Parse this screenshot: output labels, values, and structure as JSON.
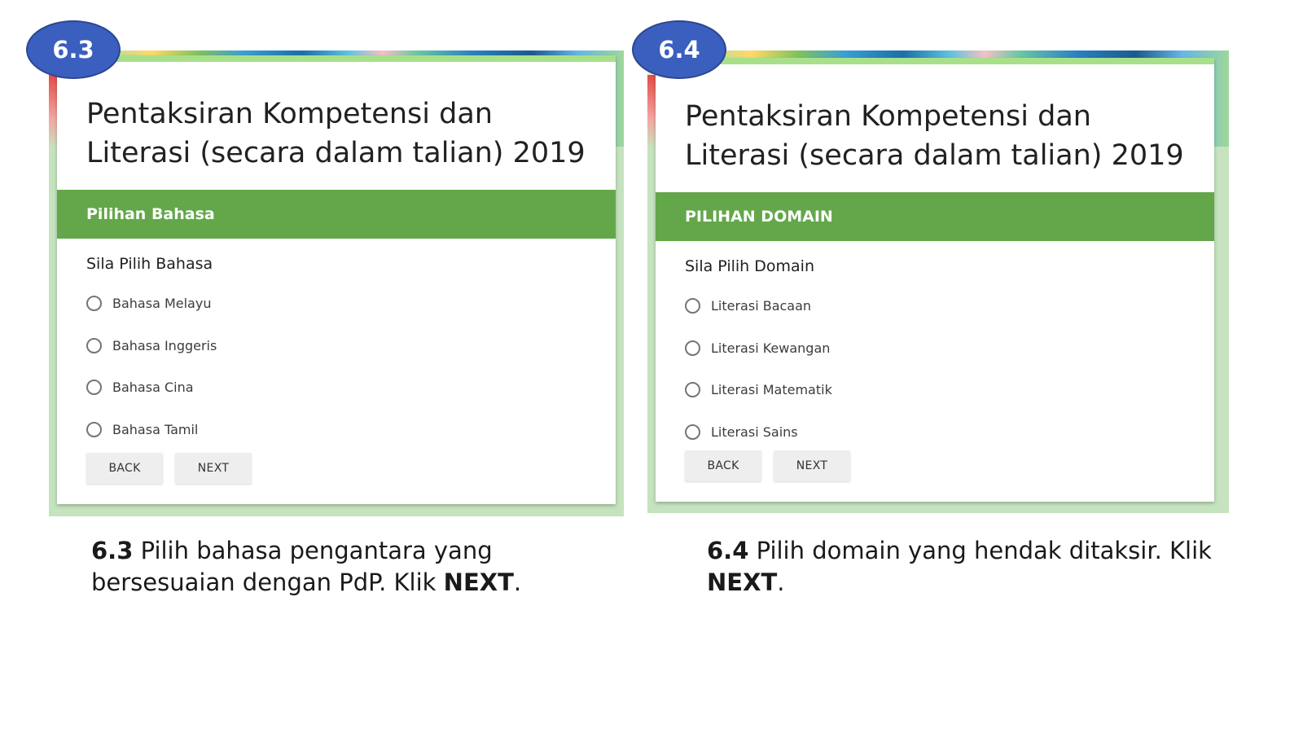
{
  "left_panel": {
    "badge": "6.3",
    "form_title": "Pentaksiran Kompetensi dan Literasi (secara dalam talian) 2019",
    "section_header": "Pilihan Bahasa",
    "question": "Sila Pilih Bahasa",
    "options": [
      "Bahasa Melayu",
      "Bahasa Inggeris",
      "Bahasa Cina",
      "Bahasa Tamil"
    ],
    "back_label": "BACK",
    "next_label": "NEXT",
    "caption": {
      "step": "6.3",
      "text_1": " Pilih bahasa pengantara yang bersesuaian dengan PdP. Klik ",
      "emphasis": "NEXT",
      "text_2": "."
    }
  },
  "right_panel": {
    "badge": "6.4",
    "form_title": "Pentaksiran Kompetensi dan Literasi (secara dalam talian) 2019",
    "section_header": "PILIHAN DOMAIN",
    "question": "Sila Pilih Domain",
    "options": [
      "Literasi Bacaan",
      "Literasi Kewangan",
      "Literasi Matematik",
      "Literasi Sains"
    ],
    "back_label": "BACK",
    "next_label": "NEXT",
    "caption": {
      "step": "6.4",
      "text_1": " Pilih domain yang hendak ditaksir. Klik ",
      "emphasis": "NEXT",
      "text_2": "."
    }
  },
  "colors": {
    "header_green": "#63a74a",
    "badge_blue": "#3b5fbe",
    "card_top_border": "#a8e08a",
    "panel_bg": "#c5e3bf"
  }
}
